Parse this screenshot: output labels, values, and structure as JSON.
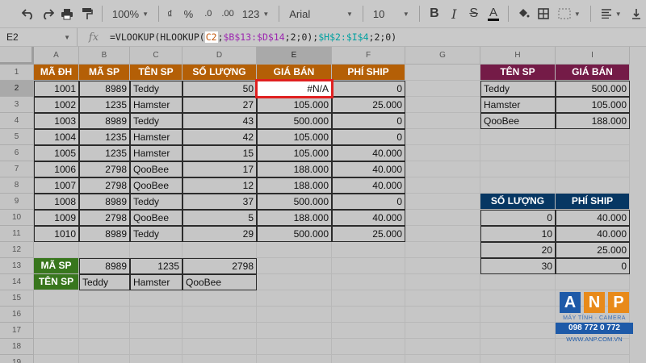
{
  "toolbar": {
    "zoom": "100%",
    "currency": "₫",
    "percent": "%",
    "dec_less": ".0",
    "dec_more": ".00",
    "more_formats": "123",
    "font": "Arial",
    "font_size": "10"
  },
  "formula_bar": {
    "cell_ref": "E2",
    "fx": "fx",
    "formula_prefix": "=VLOOKUP(HLOOKUP(",
    "ref1": "C2",
    "mid1": ";",
    "ref2": "$B$13:$D$14",
    "mid2": ";2;0);",
    "ref3": "$H$2:$I$4",
    "suffix": ";2;0)"
  },
  "columns": [
    "A",
    "B",
    "C",
    "D",
    "E",
    "F",
    "G",
    "H",
    "I"
  ],
  "rows": [
    "1",
    "2",
    "3",
    "4",
    "5",
    "6",
    "7",
    "8",
    "9",
    "10",
    "11",
    "12",
    "13",
    "14",
    "15",
    "16",
    "17",
    "18",
    "19"
  ],
  "orders": {
    "headers": [
      "MÃ ĐH",
      "MÃ SP",
      "TÊN SP",
      "SỐ LƯỢNG",
      "GIÁ BÁN",
      "PHÍ SHIP"
    ],
    "rows": [
      [
        "1001",
        "8989",
        "Teddy",
        "50",
        "#N/A",
        "0"
      ],
      [
        "1002",
        "1235",
        "Hamster",
        "27",
        "105.000",
        "25.000"
      ],
      [
        "1003",
        "8989",
        "Teddy",
        "43",
        "500.000",
        "0"
      ],
      [
        "1004",
        "1235",
        "Hamster",
        "42",
        "105.000",
        "0"
      ],
      [
        "1005",
        "1235",
        "Hamster",
        "15",
        "105.000",
        "40.000"
      ],
      [
        "1006",
        "2798",
        "QooBee",
        "17",
        "188.000",
        "40.000"
      ],
      [
        "1007",
        "2798",
        "QooBee",
        "12",
        "188.000",
        "40.000"
      ],
      [
        "1008",
        "8989",
        "Teddy",
        "37",
        "500.000",
        "0"
      ],
      [
        "1009",
        "2798",
        "QooBee",
        "5",
        "188.000",
        "40.000"
      ],
      [
        "1010",
        "8989",
        "Teddy",
        "29",
        "500.000",
        "25.000"
      ]
    ]
  },
  "product_lookup": {
    "row1_label": "MÃ SP",
    "row1": [
      "8989",
      "1235",
      "2798"
    ],
    "row2_label": "TÊN SP",
    "row2": [
      "Teddy",
      "Hamster",
      "QooBee"
    ]
  },
  "price_table": {
    "headers": [
      "TÊN SP",
      "GIÁ BÁN"
    ],
    "rows": [
      [
        "Teddy",
        "500.000"
      ],
      [
        "Hamster",
        "105.000"
      ],
      [
        "QooBee",
        "188.000"
      ]
    ]
  },
  "ship_table": {
    "headers": [
      "SỐ LƯỢNG",
      "PHÍ SHIP"
    ],
    "rows": [
      [
        "0",
        "40.000"
      ],
      [
        "10",
        "40.000"
      ],
      [
        "20",
        "25.000"
      ],
      [
        "30",
        "0"
      ]
    ]
  },
  "logo": {
    "letters": [
      "A",
      "N",
      "P"
    ],
    "tagline": "MÁY TÍNH · CAMERA",
    "phone": "098 772 0 772",
    "web": "WWW.ANP.COM.VN"
  },
  "colors": {
    "orange_header": "#b45f06",
    "purple_header": "#741b47",
    "navy_header": "#073763",
    "green_header": "#38761d",
    "active_outline": "#e02020"
  }
}
